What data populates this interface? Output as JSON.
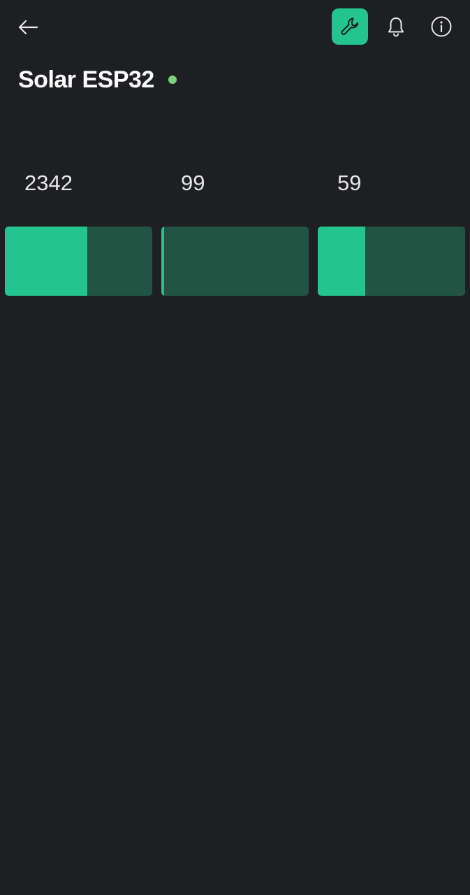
{
  "header": {
    "back_icon": "arrow-left-icon",
    "wrench_icon": "wrench-icon",
    "bell_icon": "bell-icon",
    "info_icon": "info-icon"
  },
  "device": {
    "title": "Solar ESP32",
    "status": "online"
  },
  "widgets": [
    {
      "value": "2342",
      "fill_fraction": 0.56
    },
    {
      "value": "99",
      "fill_fraction": 0.02
    },
    {
      "value": "59",
      "fill_fraction": 0.32
    }
  ],
  "colors": {
    "background": "#1e1f22",
    "accent": "#23c48e",
    "bar_track": "#215443",
    "status_online": "#7bd07b",
    "icon": "#e8e8e8"
  }
}
